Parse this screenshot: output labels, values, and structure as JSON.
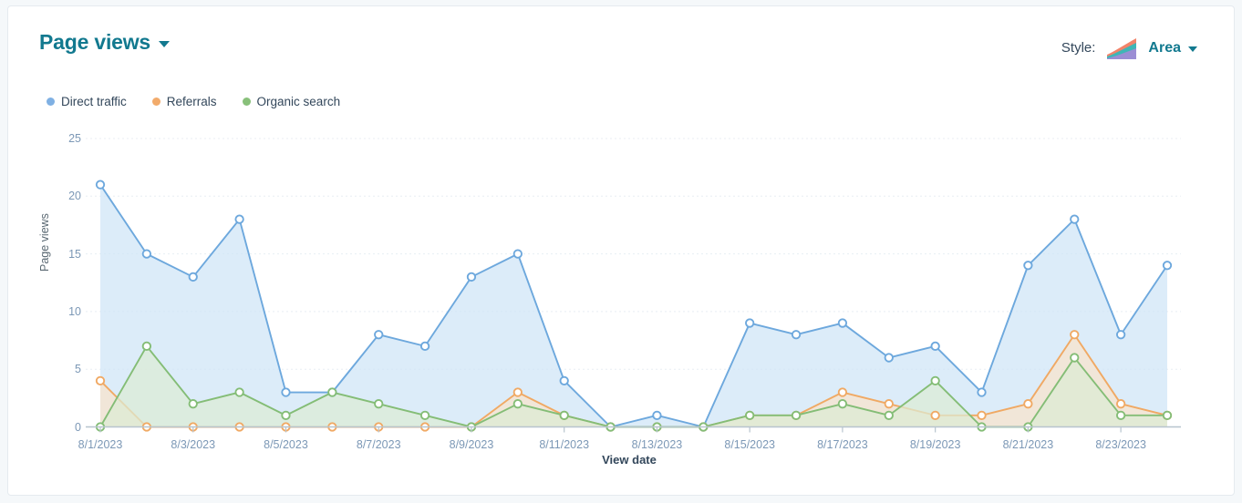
{
  "header": {
    "title": "Page views",
    "style_label": "Style:",
    "style_value": "Area"
  },
  "legend": [
    {
      "label": "Direct traffic",
      "color": "#7fb0e3"
    },
    {
      "label": "Referrals",
      "color": "#f2ab6b"
    },
    {
      "label": "Organic search",
      "color": "#88c07a"
    }
  ],
  "colors": {
    "title": "#12798f",
    "direct_line": "#6da8dd",
    "direct_fill": "#cfe4f7",
    "referrals_line": "#f0a964",
    "referrals_fill": "#fae3cb",
    "organic_line": "#84bd76",
    "organic_fill": "#dcebd4",
    "grid": "#e8eef3",
    "axis": "#b7c4ce",
    "tick_text": "#7c98b6",
    "thumb_salmon": "#f2836a",
    "thumb_teal": "#3fb6b6",
    "thumb_purple": "#9b8ed4"
  },
  "chart_data": {
    "type": "area",
    "title": "Page views",
    "xlabel": "View date",
    "ylabel": "Page views",
    "ylim": [
      0,
      25
    ],
    "yticks": [
      0,
      5,
      10,
      15,
      20,
      25
    ],
    "grid": true,
    "legend_position": "top-left",
    "stacked": false,
    "x": [
      "8/1/2023",
      "8/2/2023",
      "8/3/2023",
      "8/4/2023",
      "8/5/2023",
      "8/6/2023",
      "8/7/2023",
      "8/8/2023",
      "8/9/2023",
      "8/10/2023",
      "8/11/2023",
      "8/12/2023",
      "8/13/2023",
      "8/14/2023",
      "8/15/2023",
      "8/16/2023",
      "8/17/2023",
      "8/18/2023",
      "8/19/2023",
      "8/20/2023",
      "8/21/2023",
      "8/22/2023",
      "8/23/2023",
      "8/24/2023"
    ],
    "xticklabels": [
      "8/1/2023",
      "8/3/2023",
      "8/5/2023",
      "8/7/2023",
      "8/9/2023",
      "8/11/2023",
      "8/13/2023",
      "8/15/2023",
      "8/17/2023",
      "8/19/2023",
      "8/21/2023",
      "8/23/2023"
    ],
    "series": [
      {
        "name": "Direct traffic",
        "color": "#6da8dd",
        "fill": "#cfe4f7",
        "values": [
          21,
          15,
          13,
          18,
          3,
          3,
          8,
          7,
          13,
          15,
          4,
          0,
          1,
          0,
          9,
          8,
          9,
          6,
          7,
          3,
          14,
          18,
          8,
          14
        ]
      },
      {
        "name": "Referrals",
        "color": "#f0a964",
        "fill": "#fae3cb",
        "values": [
          4,
          0,
          0,
          0,
          0,
          0,
          0,
          0,
          0,
          3,
          1,
          0,
          0,
          0,
          1,
          1,
          3,
          2,
          1,
          1,
          2,
          8,
          2,
          1
        ]
      },
      {
        "name": "Organic search",
        "color": "#84bd76",
        "fill": "#dcebd4",
        "values": [
          0,
          7,
          2,
          3,
          1,
          3,
          2,
          1,
          0,
          2,
          1,
          0,
          0,
          0,
          1,
          1,
          2,
          1,
          4,
          0,
          0,
          6,
          1,
          1
        ]
      }
    ]
  }
}
